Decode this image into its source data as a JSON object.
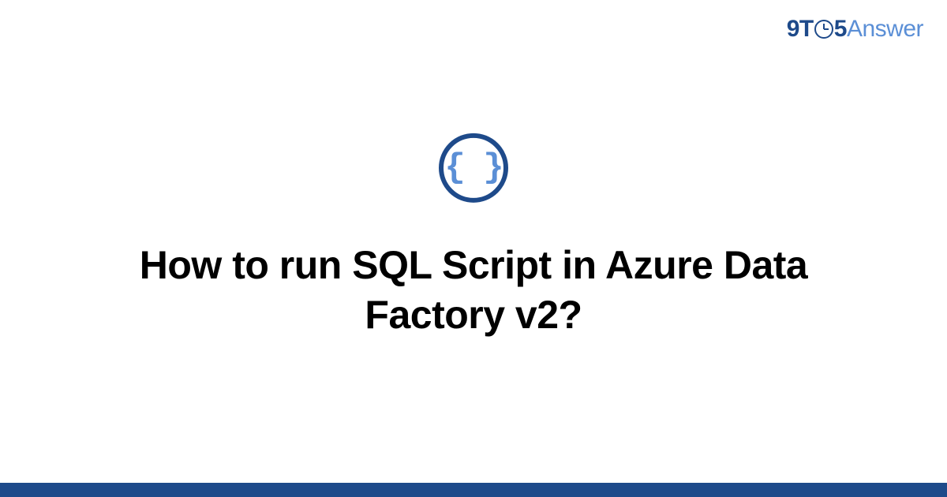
{
  "brand": {
    "prefix": "9T",
    "middle": "5",
    "suffix": "Answer"
  },
  "icon": {
    "glyph": "{ }"
  },
  "title": "How to run SQL Script in Azure Data Factory v2?",
  "colors": {
    "primary": "#1e4a8a",
    "accent": "#5b8fd6"
  }
}
